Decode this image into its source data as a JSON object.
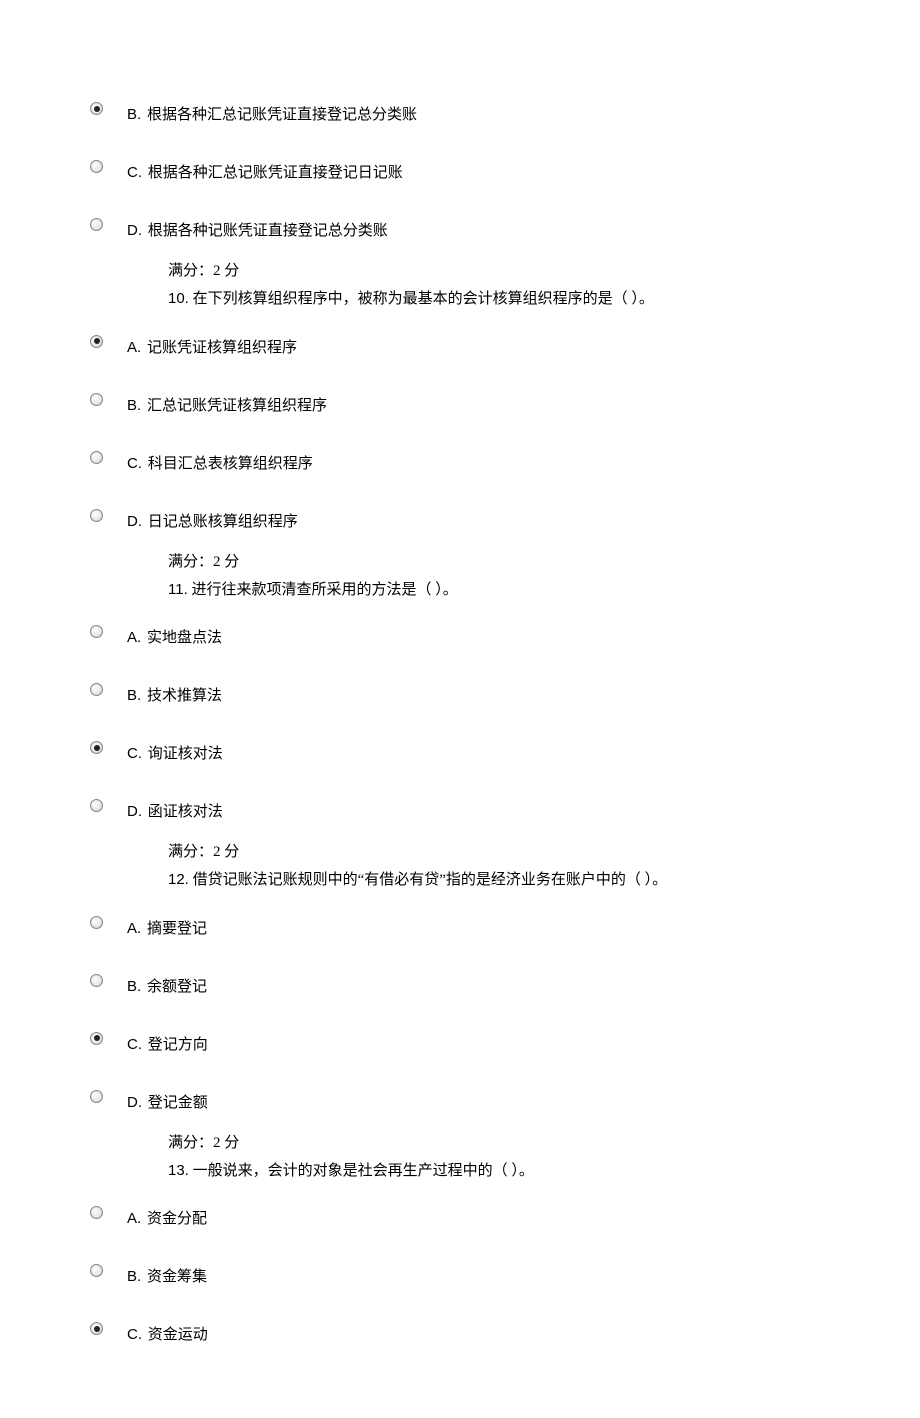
{
  "groups": [
    {
      "prefix_options": [
        {
          "letter": "B.",
          "text": "根据各种汇总记账凭证直接登记总分类账",
          "selected": true
        },
        {
          "letter": "C.",
          "text": "根据各种汇总记账凭证直接登记日记账",
          "selected": false
        },
        {
          "letter": "D.",
          "text": "根据各种记账凭证直接登记总分类账",
          "selected": false
        }
      ],
      "score": "满分：2  分",
      "q_num": "10.",
      "q_text": "  在下列核算组织程序中，被称为最基本的会计核算组织程序的是（  ）。",
      "options": [
        {
          "letter": "A.",
          "text": "记账凭证核算组织程序",
          "selected": true
        },
        {
          "letter": "B.",
          "text": "汇总记账凭证核算组织程序",
          "selected": false
        },
        {
          "letter": "C.",
          "text": "科目汇总表核算组织程序",
          "selected": false
        },
        {
          "letter": "D.",
          "text": "日记总账核算组织程序",
          "selected": false
        }
      ]
    },
    {
      "prefix_options": [],
      "score": "满分：2  分",
      "q_num": "11.",
      "q_text": "  进行往来款项清查所采用的方法是（  ）。",
      "options": [
        {
          "letter": "A.",
          "text": "实地盘点法",
          "selected": false
        },
        {
          "letter": "B.",
          "text": "技术推算法",
          "selected": false
        },
        {
          "letter": "C.",
          "text": "询证核对法",
          "selected": true
        },
        {
          "letter": "D.",
          "text": "函证核对法",
          "selected": false
        }
      ]
    },
    {
      "prefix_options": [],
      "score": "满分：2  分",
      "q_num": "12.",
      "q_text": "  借贷记账法记账规则中的“有借必有贷”指的是经济业务在账户中的（  ）。",
      "options": [
        {
          "letter": "A.",
          "text": "摘要登记",
          "selected": false
        },
        {
          "letter": "B.",
          "text": "余额登记",
          "selected": false
        },
        {
          "letter": "C.",
          "text": "登记方向",
          "selected": true
        },
        {
          "letter": "D.",
          "text": "登记金额",
          "selected": false
        }
      ]
    },
    {
      "prefix_options": [],
      "score": "满分：2  分",
      "q_num": "13.",
      "q_text": "  一般说来，会计的对象是社会再生产过程中的（  ）。",
      "options": [
        {
          "letter": "A.",
          "text": "资金分配",
          "selected": false
        },
        {
          "letter": "B.",
          "text": "资金筹集",
          "selected": false
        },
        {
          "letter": "C.",
          "text": "资金运动",
          "selected": true
        }
      ]
    }
  ]
}
